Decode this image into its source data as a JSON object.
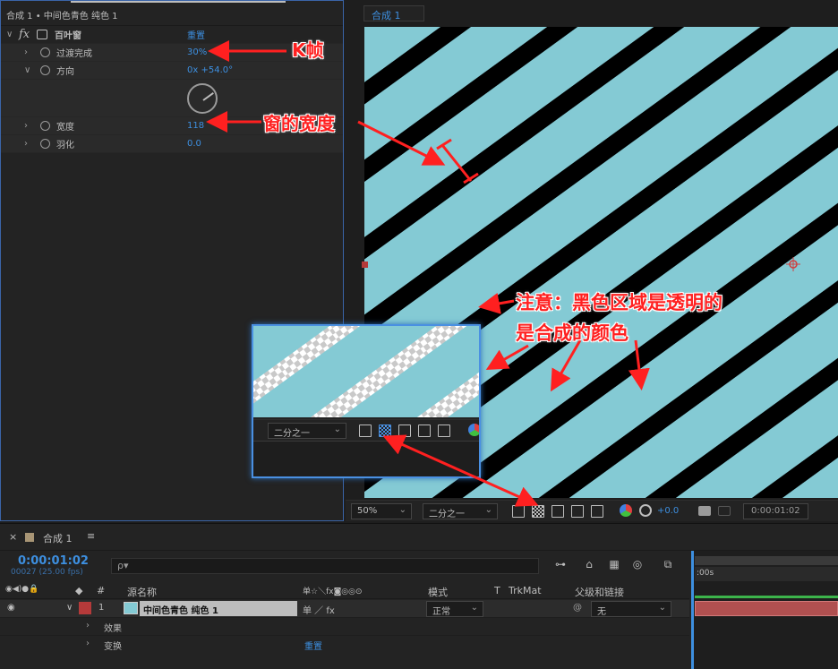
{
  "effects_panel": {
    "header": "合成 1 • 中间色青色 纯色 1",
    "effect_name": "百叶窗",
    "reset_label": "重置",
    "properties": [
      {
        "label": "过渡完成",
        "value": "30%"
      },
      {
        "label": "方向",
        "value": "0x +54.0°"
      },
      {
        "label": "宽度",
        "value": "118"
      },
      {
        "label": "羽化",
        "value": "0.0"
      }
    ]
  },
  "viewer": {
    "comp_tab": "合成 1",
    "stripe_color": "#84cad4",
    "transparent_color": "#000000",
    "toolbar": {
      "zoom": "50%",
      "resolution": "二分之一",
      "exposure": "+0.0",
      "timecode": "0:00:01:02"
    }
  },
  "inset": {
    "resolution": "二分之一"
  },
  "annotations": {
    "keyframe": "K帧",
    "width_note": "窗的宽度",
    "transparent_note_line1": "注意：黑色区域是透明的",
    "transparent_note_line2": "是合成的颜色"
  },
  "timeline": {
    "tab_title": "合成 1",
    "current_time": "0:00:01:02",
    "frames": "00027 (25.00 fps)",
    "search_placeholder": "ρ▾",
    "columns": {
      "num": "#",
      "source_name": "源名称",
      "switches": "单☆＼fx◙◎◎⊙",
      "mode": "模式",
      "t": "T",
      "trkmat": "TrkMat",
      "parent": "父级和链接"
    },
    "layer": {
      "index": "1",
      "name": "中间色青色 纯色 1",
      "mode": "正常",
      "parent": "无",
      "label_color": "#b53a3a",
      "source_color": "#84cad4"
    },
    "sub_rows": [
      {
        "label": "效果"
      },
      {
        "label": "变换",
        "value": "重置"
      }
    ],
    "ruler_label": ":00s"
  }
}
